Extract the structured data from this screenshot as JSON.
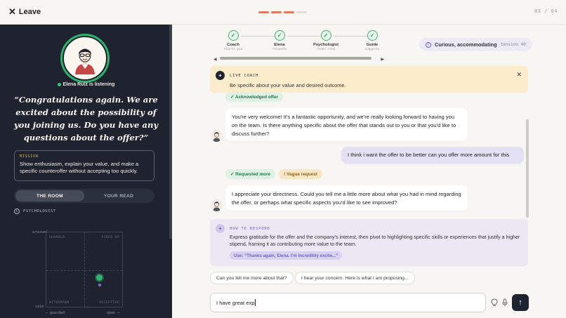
{
  "topbar": {
    "leave_label": "Leave",
    "progress": {
      "total": 4,
      "completed": 3
    },
    "page_count": "03 / 04"
  },
  "left": {
    "listening": "Elena Ruiz is listening",
    "quote": "“Congratulations again. We are excited about the possibility of you joining us. Do you have any questions about the offer?”",
    "mission_label": "MISSION",
    "mission_text": "Show enthusiasm, explain your value, and make a specific counteroffer without accepting too quickly.",
    "tabs": [
      {
        "label": "THE ROOM",
        "active": true
      },
      {
        "label": "YOUR READ",
        "active": false
      }
    ],
    "psychologist_label": "PSYCHOLOGIST",
    "grid": {
      "q_tl": "GUARDED",
      "q_tr": "FIRED UP",
      "q_bl": "WITHDRAWN",
      "q_br": "RECEPTIVE",
      "y_top": "aroused",
      "y_bottom": "calm",
      "x_left": "← guarded",
      "x_right": "open →"
    }
  },
  "steps": [
    {
      "name": "Coach",
      "sub": "starts you"
    },
    {
      "name": "Elena",
      "sub": "responds"
    },
    {
      "name": "Psychologist",
      "sub": "reads room"
    },
    {
      "name": "Guide",
      "sub": "suggests"
    }
  ],
  "mood": {
    "label": "Curious, accommodating",
    "tension": "tension 40"
  },
  "coach": {
    "label": "LIVE COACH",
    "text": "Be specific about your value and desired outcome."
  },
  "chat": {
    "tag1": "✓ Acknowledged offer",
    "msg1": "You're very welcome! It's a fantastic opportunity, and we're really looking forward to having you on the team. Is there anything specific about the offer that stands out to you or that you'd like to discuss further?",
    "user1": "I think i want the offer to be better can you offer more amount for this",
    "tag2": "✓ Requested more",
    "tag3": "! Vague request",
    "msg2": "I appreciate your directness. Could you tell me a little more about what you had in mind regarding the offer, or perhaps what specific aspects you'd like to see improved?"
  },
  "respond": {
    "label": "HOW TO RESPOND",
    "text": "Express gratitude for the offer and the company's interest, then pivot to highlighting specific skills or experiences that justify a higher stipend, framing it as contributing more value to the team.",
    "use": "Use: “Thanks again, Elena. I'm incredibly excite...”"
  },
  "suggestions": [
    "Can you tell me more about that?",
    "I hear your concern. Here is what I am proposing..."
  ],
  "input": {
    "value": "I have great exp"
  },
  "colors": {
    "accent": "#e07a5f",
    "panel": "#1f2330",
    "green": "#2fb36b",
    "coach_bg": "#fbeccb",
    "respond_bg": "#ebe8f3",
    "user_bubble": "#e4e1f4"
  },
  "icons": [
    "close-icon",
    "check-icon",
    "lightbulb-icon",
    "microphone-icon",
    "arrow-up-icon",
    "info-icon"
  ]
}
